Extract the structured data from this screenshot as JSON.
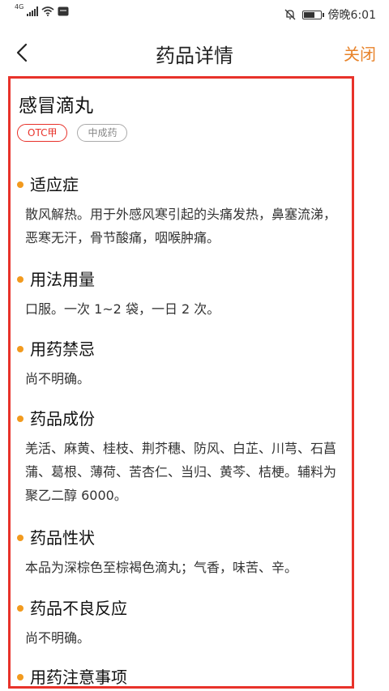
{
  "status_bar": {
    "network": "4G",
    "time": "傍晚6:01",
    "battery_level": 0.7
  },
  "nav": {
    "title": "药品详情",
    "close_label": "关闭"
  },
  "drug": {
    "name": "感冒滴丸",
    "tags": [
      "OTC甲",
      "中成药"
    ]
  },
  "sections": [
    {
      "title": "适应症",
      "body": "散风解热。用于外感风寒引起的头痛发热，鼻塞流涕，恶寒无汗，骨节酸痛，咽喉肿痛。"
    },
    {
      "title": "用法用量",
      "body": "口服。一次 1~2 袋，一日 2 次。"
    },
    {
      "title": "用药禁忌",
      "body": "尚不明确。"
    },
    {
      "title": "药品成份",
      "body": "羌活、麻黄、桂枝、荆芥穗、防风、白芷、川芎、石菖蒲、葛根、薄荷、苦杏仁、当归、黄芩、桔梗。辅料为聚乙二醇 6000。"
    },
    {
      "title": "药品性状",
      "body": "本品为深棕色至棕褐色滴丸；气香，味苦、辛。"
    },
    {
      "title": "药品不良反应",
      "body": "尚不明确。"
    },
    {
      "title": "用药注意事项",
      "body": ""
    }
  ]
}
